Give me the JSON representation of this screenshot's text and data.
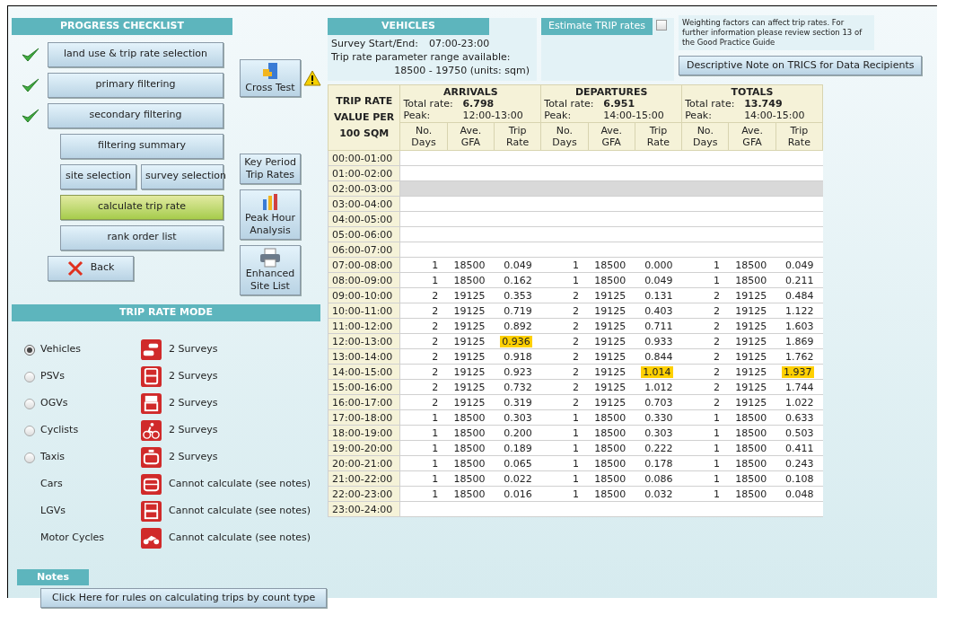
{
  "progress_checklist": {
    "title": "PROGRESS CHECKLIST",
    "steps": [
      {
        "label": "land use & trip rate selection",
        "done": true,
        "kind": "main"
      },
      {
        "label": "primary filtering",
        "done": true,
        "kind": "main"
      },
      {
        "label": "secondary filtering",
        "done": true,
        "kind": "main"
      },
      {
        "label": "filtering summary",
        "kind": "sub"
      },
      {
        "label": "site selection",
        "kind": "pair"
      },
      {
        "label": "survey selection",
        "kind": "pair"
      },
      {
        "label": "calculate trip rate",
        "kind": "current"
      },
      {
        "label": "rank order list",
        "kind": "sub"
      }
    ],
    "back": "Back"
  },
  "tools": [
    {
      "label": "Cross Test",
      "kind": "cross",
      "warning": true
    },
    {
      "label": "Key Period Trip Rates",
      "kind": "plain",
      "warning": false
    },
    {
      "label": "Peak Hour Analysis",
      "kind": "chart",
      "warning": false
    },
    {
      "label": "Enhanced Site List",
      "kind": "print",
      "warning": false
    }
  ],
  "trip_rate_mode": {
    "title": "TRIP RATE MODE",
    "modes": [
      {
        "label": "Vehicles",
        "selected": true,
        "kind": "cars",
        "surveys": "2 Surveys"
      },
      {
        "label": "PSVs",
        "selected": false,
        "kind": "bus",
        "surveys": "2 Surveys"
      },
      {
        "label": "OGVs",
        "selected": false,
        "kind": "truck",
        "surveys": "2 Surveys"
      },
      {
        "label": "Cyclists",
        "selected": false,
        "kind": "cycle",
        "surveys": "2 Surveys"
      },
      {
        "label": "Taxis",
        "selected": false,
        "kind": "taxi",
        "surveys": "2 Surveys"
      },
      {
        "label": "Cars",
        "kind": "car",
        "surveys": "Cannot calculate (see notes)"
      },
      {
        "label": "LGVs",
        "kind": "van",
        "surveys": "Cannot calculate (see notes)"
      },
      {
        "label": "Motor Cycles",
        "kind": "moto",
        "surveys": "Cannot calculate (see notes)"
      }
    ]
  },
  "notes": {
    "title": "Notes",
    "button": "Click Here for rules on calculating trips by count type"
  },
  "vehicles": {
    "title": "VEHICLES",
    "survey_label": "Survey Start/End:",
    "survey_value": "07:00-23:00",
    "range_label": "Trip rate parameter range available:",
    "range_value": "18500 - 19750 (units: sqm)"
  },
  "estimate": {
    "label": "Estimate TRIP rates",
    "checked": false
  },
  "weighting_note": "Weighting factors can affect trip rates. For further information please review section 13 of the Good Practice Guide",
  "descriptive_button": "Descriptive Note on TRICS for Data Recipients",
  "table": {
    "corner": "TRIP RATE VALUE PER 100 SQM",
    "groups": [
      {
        "title": "ARRIVALS",
        "total_label": "Total rate:",
        "total": "6.798",
        "peak_label": "Peak:",
        "peak": "12:00-13:00",
        "columns": [
          "No. Days",
          "Ave. GFA",
          "Trip Rate"
        ]
      },
      {
        "title": "DEPARTURES",
        "total_label": "Total rate:",
        "total": "6.951",
        "peak_label": "Peak:",
        "peak": "14:00-15:00",
        "columns": [
          "No. Days",
          "Ave. GFA",
          "Trip Rate"
        ]
      },
      {
        "title": "TOTALS",
        "total_label": "Total rate:",
        "total": "13.749",
        "peak_label": "Peak:",
        "peak": "14:00-15:00",
        "columns": [
          "No. Days",
          "Ave. GFA",
          "Trip Rate"
        ]
      }
    ],
    "rows": [
      {
        "time": "00:00-01:00",
        "selected": false,
        "groups": []
      },
      {
        "time": "01:00-02:00",
        "selected": false,
        "groups": []
      },
      {
        "time": "02:00-03:00",
        "selected": true,
        "groups": []
      },
      {
        "time": "03:00-04:00",
        "selected": false,
        "groups": []
      },
      {
        "time": "04:00-05:00",
        "selected": false,
        "groups": []
      },
      {
        "time": "05:00-06:00",
        "selected": false,
        "groups": []
      },
      {
        "time": "06:00-07:00",
        "selected": false,
        "groups": []
      },
      {
        "time": "07:00-08:00",
        "selected": false,
        "groups": [
          {
            "days": "1",
            "gfa": "18500",
            "rate": "0.049",
            "peak": false
          },
          {
            "days": "1",
            "gfa": "18500",
            "rate": "0.000",
            "peak": false
          },
          {
            "days": "1",
            "gfa": "18500",
            "rate": "0.049",
            "peak": false
          }
        ]
      },
      {
        "time": "08:00-09:00",
        "selected": false,
        "groups": [
          {
            "days": "1",
            "gfa": "18500",
            "rate": "0.162",
            "peak": false
          },
          {
            "days": "1",
            "gfa": "18500",
            "rate": "0.049",
            "peak": false
          },
          {
            "days": "1",
            "gfa": "18500",
            "rate": "0.211",
            "peak": false
          }
        ]
      },
      {
        "time": "09:00-10:00",
        "selected": false,
        "groups": [
          {
            "days": "2",
            "gfa": "19125",
            "rate": "0.353",
            "peak": false
          },
          {
            "days": "2",
            "gfa": "19125",
            "rate": "0.131",
            "peak": false
          },
          {
            "days": "2",
            "gfa": "19125",
            "rate": "0.484",
            "peak": false
          }
        ]
      },
      {
        "time": "10:00-11:00",
        "selected": false,
        "groups": [
          {
            "days": "2",
            "gfa": "19125",
            "rate": "0.719",
            "peak": false
          },
          {
            "days": "2",
            "gfa": "19125",
            "rate": "0.403",
            "peak": false
          },
          {
            "days": "2",
            "gfa": "19125",
            "rate": "1.122",
            "peak": false
          }
        ]
      },
      {
        "time": "11:00-12:00",
        "selected": false,
        "groups": [
          {
            "days": "2",
            "gfa": "19125",
            "rate": "0.892",
            "peak": false
          },
          {
            "days": "2",
            "gfa": "19125",
            "rate": "0.711",
            "peak": false
          },
          {
            "days": "2",
            "gfa": "19125",
            "rate": "1.603",
            "peak": false
          }
        ]
      },
      {
        "time": "12:00-13:00",
        "selected": false,
        "groups": [
          {
            "days": "2",
            "gfa": "19125",
            "rate": "0.936",
            "peak": true
          },
          {
            "days": "2",
            "gfa": "19125",
            "rate": "0.933",
            "peak": false
          },
          {
            "days": "2",
            "gfa": "19125",
            "rate": "1.869",
            "peak": false
          }
        ]
      },
      {
        "time": "13:00-14:00",
        "selected": false,
        "groups": [
          {
            "days": "2",
            "gfa": "19125",
            "rate": "0.918",
            "peak": false
          },
          {
            "days": "2",
            "gfa": "19125",
            "rate": "0.844",
            "peak": false
          },
          {
            "days": "2",
            "gfa": "19125",
            "rate": "1.762",
            "peak": false
          }
        ]
      },
      {
        "time": "14:00-15:00",
        "selected": false,
        "groups": [
          {
            "days": "2",
            "gfa": "19125",
            "rate": "0.923",
            "peak": false
          },
          {
            "days": "2",
            "gfa": "19125",
            "rate": "1.014",
            "peak": true
          },
          {
            "days": "2",
            "gfa": "19125",
            "rate": "1.937",
            "peak": true
          }
        ]
      },
      {
        "time": "15:00-16:00",
        "selected": false,
        "groups": [
          {
            "days": "2",
            "gfa": "19125",
            "rate": "0.732",
            "peak": false
          },
          {
            "days": "2",
            "gfa": "19125",
            "rate": "1.012",
            "peak": false
          },
          {
            "days": "2",
            "gfa": "19125",
            "rate": "1.744",
            "peak": false
          }
        ]
      },
      {
        "time": "16:00-17:00",
        "selected": false,
        "groups": [
          {
            "days": "2",
            "gfa": "19125",
            "rate": "0.319",
            "peak": false
          },
          {
            "days": "2",
            "gfa": "19125",
            "rate": "0.703",
            "peak": false
          },
          {
            "days": "2",
            "gfa": "19125",
            "rate": "1.022",
            "peak": false
          }
        ]
      },
      {
        "time": "17:00-18:00",
        "selected": false,
        "groups": [
          {
            "days": "1",
            "gfa": "18500",
            "rate": "0.303",
            "peak": false
          },
          {
            "days": "1",
            "gfa": "18500",
            "rate": "0.330",
            "peak": false
          },
          {
            "days": "1",
            "gfa": "18500",
            "rate": "0.633",
            "peak": false
          }
        ]
      },
      {
        "time": "18:00-19:00",
        "selected": false,
        "groups": [
          {
            "days": "1",
            "gfa": "18500",
            "rate": "0.200",
            "peak": false
          },
          {
            "days": "1",
            "gfa": "18500",
            "rate": "0.303",
            "peak": false
          },
          {
            "days": "1",
            "gfa": "18500",
            "rate": "0.503",
            "peak": false
          }
        ]
      },
      {
        "time": "19:00-20:00",
        "selected": false,
        "groups": [
          {
            "days": "1",
            "gfa": "18500",
            "rate": "0.189",
            "peak": false
          },
          {
            "days": "1",
            "gfa": "18500",
            "rate": "0.222",
            "peak": false
          },
          {
            "days": "1",
            "gfa": "18500",
            "rate": "0.411",
            "peak": false
          }
        ]
      },
      {
        "time": "20:00-21:00",
        "selected": false,
        "groups": [
          {
            "days": "1",
            "gfa": "18500",
            "rate": "0.065",
            "peak": false
          },
          {
            "days": "1",
            "gfa": "18500",
            "rate": "0.178",
            "peak": false
          },
          {
            "days": "1",
            "gfa": "18500",
            "rate": "0.243",
            "peak": false
          }
        ]
      },
      {
        "time": "21:00-22:00",
        "selected": false,
        "groups": [
          {
            "days": "1",
            "gfa": "18500",
            "rate": "0.022",
            "peak": false
          },
          {
            "days": "1",
            "gfa": "18500",
            "rate": "0.086",
            "peak": false
          },
          {
            "days": "1",
            "gfa": "18500",
            "rate": "0.108",
            "peak": false
          }
        ]
      },
      {
        "time": "22:00-23:00",
        "selected": false,
        "groups": [
          {
            "days": "1",
            "gfa": "18500",
            "rate": "0.016",
            "peak": false
          },
          {
            "days": "1",
            "gfa": "18500",
            "rate": "0.032",
            "peak": false
          },
          {
            "days": "1",
            "gfa": "18500",
            "rate": "0.048",
            "peak": false
          }
        ]
      },
      {
        "time": "23:00-24:00",
        "selected": false,
        "groups": []
      }
    ]
  }
}
